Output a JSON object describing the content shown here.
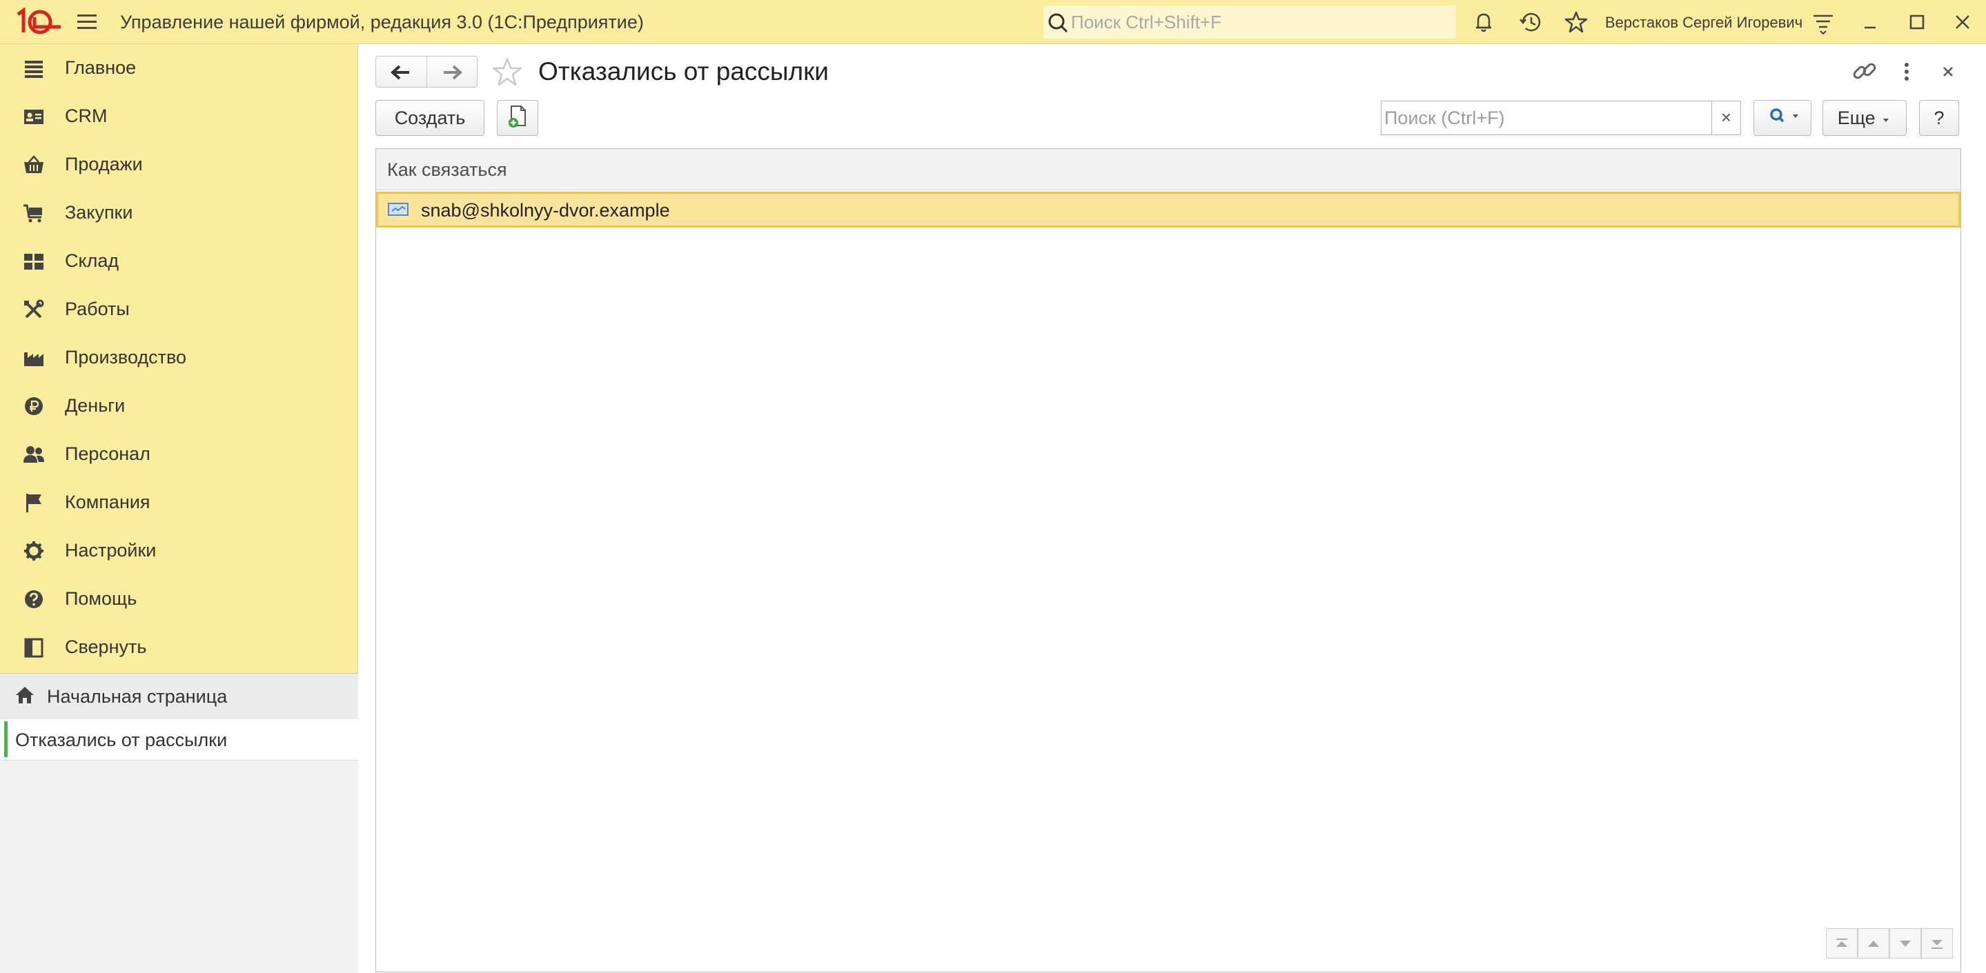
{
  "app": {
    "title": "Управление нашей фирмой, редакция 3.0  (1С:Предприятие)",
    "search_placeholder": "Поиск Ctrl+Shift+F",
    "user": "Верстаков Сергей Игоревич",
    "brand_color": "#fbed9e"
  },
  "sidebar": {
    "items": [
      {
        "label": "Главное",
        "icon": "list-icon"
      },
      {
        "label": "CRM",
        "icon": "contact-card-icon"
      },
      {
        "label": "Продажи",
        "icon": "basket-icon"
      },
      {
        "label": "Закупки",
        "icon": "cart-icon"
      },
      {
        "label": "Склад",
        "icon": "warehouse-grid-icon"
      },
      {
        "label": "Работы",
        "icon": "tools-icon"
      },
      {
        "label": "Производство",
        "icon": "factory-icon"
      },
      {
        "label": "Деньги",
        "icon": "ruble-icon"
      },
      {
        "label": "Персонал",
        "icon": "people-icon"
      },
      {
        "label": "Компания",
        "icon": "flag-icon"
      },
      {
        "label": "Настройки",
        "icon": "gear-icon"
      },
      {
        "label": "Помощь",
        "icon": "help-icon"
      },
      {
        "label": "Свернуть",
        "icon": "collapse-panel-icon"
      }
    ]
  },
  "open_pages": {
    "home": "Начальная страница",
    "current": "Отказались от рассылки"
  },
  "form": {
    "title": "Отказались от рассылки",
    "create_label": "Создать",
    "search_placeholder": "Поиск (Ctrl+F)",
    "clear_label": "×",
    "more_label": "Еще",
    "help_label": "?",
    "columns": [
      "Как связаться"
    ],
    "rows": [
      {
        "contact": "snab@shkolnyy-dvor.example",
        "icon": "email-icon",
        "selected": true
      }
    ]
  }
}
